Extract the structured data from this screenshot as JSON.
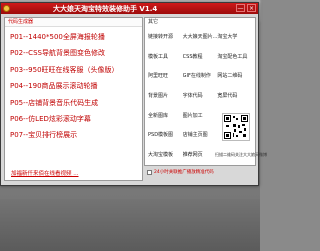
{
  "window": {
    "title": "大大娘天淘宝特效装修助手 V1.4",
    "minimize_label": "—",
    "close_label": "×"
  },
  "left_panel": {
    "header": "代码生成器",
    "items": [
      {
        "label": "P01--1440*500全屏海报轮播"
      },
      {
        "label": "P02--CSS导航背景图变色修改"
      },
      {
        "label": "P03--950旺旺在线客服（头像版）"
      },
      {
        "label": "P04--190商品展示滚动轮播"
      },
      {
        "label": "P05--店铺背景音乐代码生成"
      },
      {
        "label": "P06--仿LED炫彩滚动字幕"
      },
      {
        "label": "P07--宝贝排行榜展示"
      }
    ],
    "footer_link": "加福新仟来佰在线看视频 ..."
  },
  "right_panel": {
    "header": "其它",
    "tools": [
      {
        "label": "链接转开源"
      },
      {
        "label": "大大娘天图片..."
      },
      {
        "label": "淘宝大学"
      },
      {
        "label": "模板工具"
      },
      {
        "label": "CSS教程"
      },
      {
        "label": "淘宝配色工具"
      },
      {
        "label": "阿里旺旺"
      },
      {
        "label": "GIF在线制作"
      },
      {
        "label": "网站二维码"
      },
      {
        "label": "背景图片"
      },
      {
        "label": "字体代码"
      },
      {
        "label": "宽屏代码"
      },
      {
        "label": "全新图库"
      },
      {
        "label": "图片加工"
      },
      {
        "label": ""
      },
      {
        "label": "PSD模板图"
      },
      {
        "label": "店铺主页图"
      },
      {
        "label": ""
      },
      {
        "label": "大淘宝模板"
      },
      {
        "label": "推荐网页"
      },
      {
        "label": ""
      }
    ],
    "qr_caption": "扫描二维码关注大大娘天微博",
    "autoplay_label": "24小时关联推广播放精准代码"
  }
}
